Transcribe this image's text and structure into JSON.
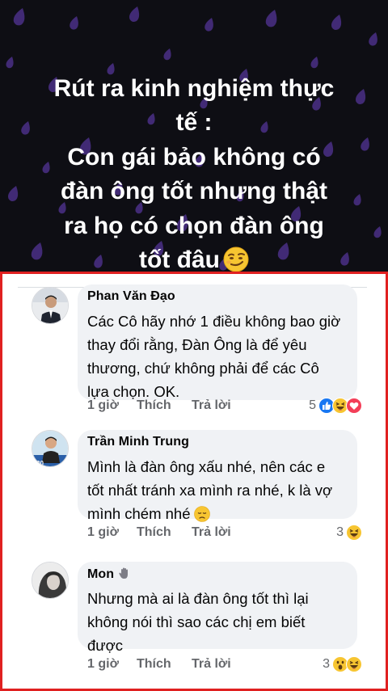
{
  "banner": {
    "title": "Rút ra kinh nghiệm thực\ntế  :\nCon gái bảo không có\nđàn ông tốt nhưng thật\nra họ có chọn đàn ông\ntốt đâu",
    "emoji": "smirk-face-icon",
    "background": "#0e0e14",
    "drop_color": "#4a2f86"
  },
  "frame_color": "#e02020",
  "comments": [
    {
      "author": "Phan Văn Đạo",
      "text": "Các Cô hãy nhớ 1 điều không bao giờ\nthay đổi rằng, Đàn Ông là để yêu\nthương, chứ không phải để các Cô\nlựa chọn. OK.",
      "time": "1 giờ",
      "like": "Thích",
      "reply": "Trả lời",
      "reaction_count": "5",
      "reactions": [
        "like",
        "haha",
        "love"
      ]
    },
    {
      "author": "Trần Minh Trung",
      "text": "Mình là đàn ông xấu nhé, nên các e\ntốt nhất tránh xa mình ra nhé, k là vợ\nmình chém nhé",
      "time": "1 giờ",
      "like": "Thích",
      "reply": "Trả lời",
      "reaction_count": "3",
      "reactions": [
        "haha"
      ]
    },
    {
      "author": "Mon",
      "text": "Nhưng mà ai là đàn ông tốt thì lại\nkhông nói thì sao các chị em biết\nđược",
      "time": "1 giờ",
      "like": "Thích",
      "reply": "Trả lời",
      "reaction_count": "3",
      "reactions": [
        "wow",
        "haha"
      ]
    }
  ]
}
